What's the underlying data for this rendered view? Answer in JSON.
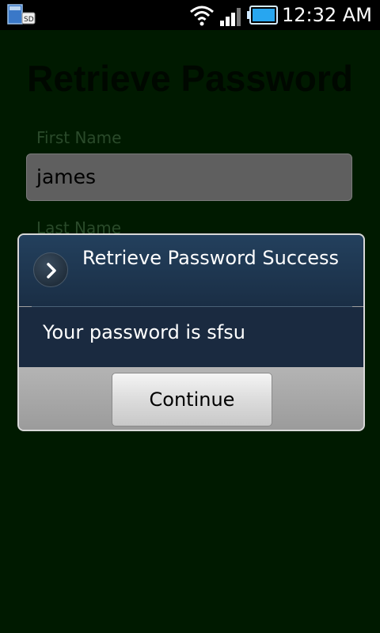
{
  "status_bar": {
    "time": "12:32 AM",
    "sd_label": "SD",
    "icons": [
      "sd-card-icon",
      "wifi-icon",
      "signal-icon",
      "battery-icon"
    ]
  },
  "app": {
    "title": "Retrieve Password",
    "first_name_label": "First Name",
    "first_name_value": "james",
    "last_name_label": "Last Name"
  },
  "dialog": {
    "title": "Retrieve Password Success",
    "message": "Your password is sfsu",
    "continue_label": "Continue",
    "icon": "chevron-right-icon"
  },
  "colors": {
    "app_background": "#001a00",
    "dialog_header": "#1f3650",
    "dialog_footer": "#a0a0a0"
  }
}
